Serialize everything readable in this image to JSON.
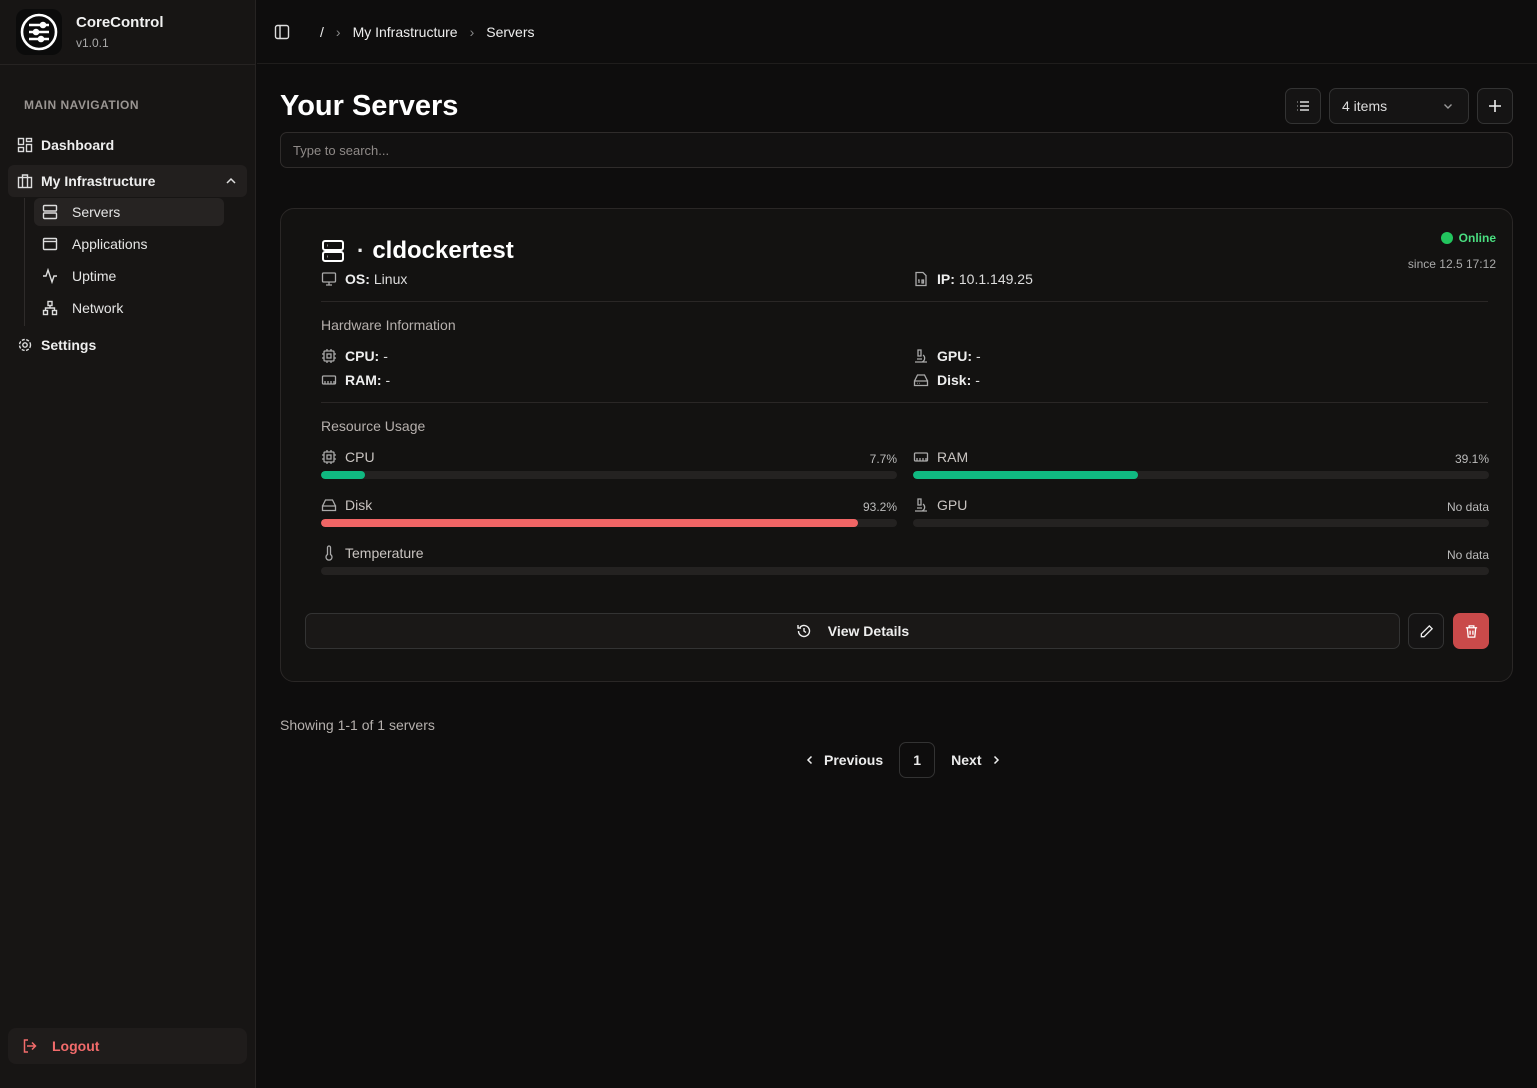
{
  "app": {
    "name": "CoreControl",
    "version": "v1.0.1"
  },
  "sidebar": {
    "section_label": "MAIN NAVIGATION",
    "dashboard": "Dashboard",
    "infrastructure": "My Infrastructure",
    "sub": [
      "Servers",
      "Applications",
      "Uptime",
      "Network"
    ],
    "settings": "Settings",
    "logout": "Logout"
  },
  "breadcrumb": {
    "root": "/",
    "parent": "My Infrastructure",
    "current": "Servers"
  },
  "page": {
    "title": "Your Servers",
    "items_select": "4 items",
    "search_placeholder": "Type to search..."
  },
  "server": {
    "name": "cldockertest",
    "dot": "·",
    "os_label": "OS:",
    "os": "Linux",
    "ip_label": "IP:",
    "ip": "10.1.149.25",
    "status": "Online",
    "since": "since 12.5 17:12",
    "status_color": "#22c55e",
    "hardware_title": "Hardware Information",
    "cpu_label": "CPU:",
    "cpu": "-",
    "ram_label": "RAM:",
    "ram": "-",
    "gpu_label": "GPU:",
    "gpu": "-",
    "disk_label": "Disk:",
    "disk": "-",
    "usage_title": "Resource Usage",
    "usage": {
      "cpu": {
        "label": "CPU",
        "text": "7.7%",
        "value": 7.7
      },
      "ram": {
        "label": "RAM",
        "text": "39.1%",
        "value": 39.1
      },
      "disk": {
        "label": "Disk",
        "text": "93.2%",
        "value": 93.2
      },
      "gpu": {
        "label": "GPU",
        "text": "No data"
      },
      "temp": {
        "label": "Temperature",
        "text": "No data"
      }
    },
    "view_details": "View Details"
  },
  "pagination": {
    "summary": "Showing 1-1 of 1 servers",
    "previous": "Previous",
    "page": "1",
    "next": "Next"
  }
}
